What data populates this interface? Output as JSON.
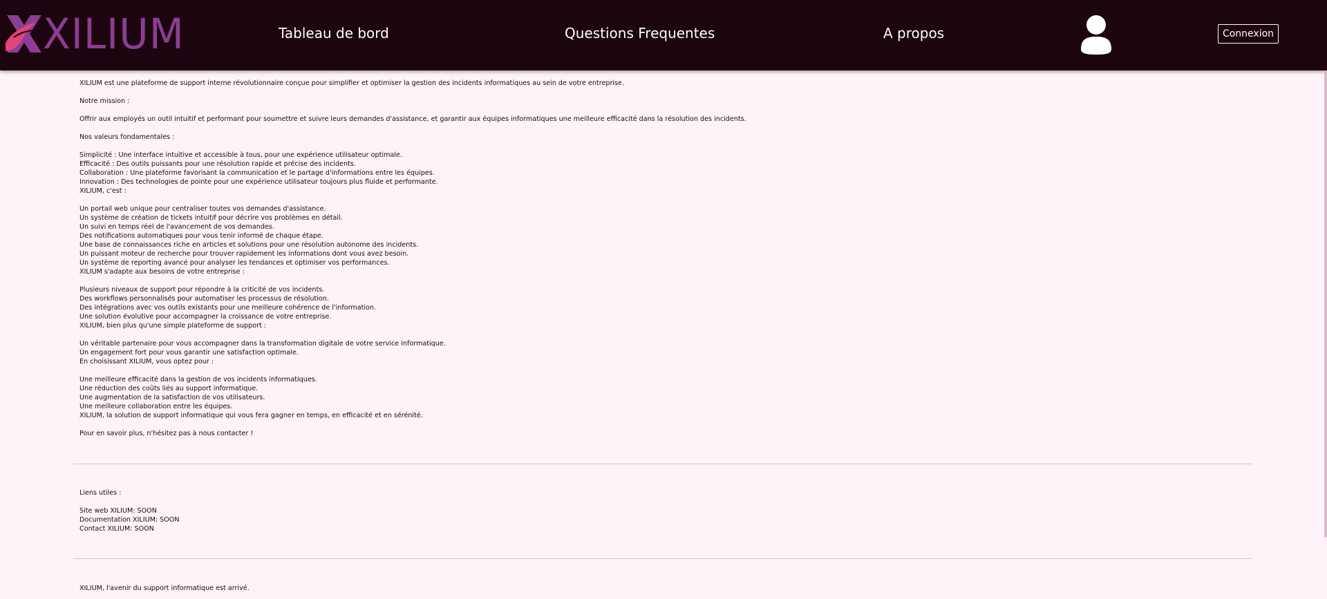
{
  "brand": {
    "name": "XILIUM",
    "logo_color": "#8c3d94",
    "logo_accent_color": "#e0457b"
  },
  "nav": {
    "dashboard_label": "Tableau de bord",
    "faq_label": "Questions Frequentes",
    "about_label": "A propos",
    "user_icon": "user-avatar-icon",
    "login_label": "Connexion"
  },
  "colors": {
    "navbar_bg": "#1c050e",
    "page_bg": "#fdf3f8",
    "text": "#1a0a10"
  },
  "content": {
    "intro": "XILIUM est une plateforme de support interne révolutionnaire conçue pour simplifier et optimiser la gestion des incidents informatiques au sein de votre entreprise.",
    "mission_title": "Notre mission :",
    "mission_text": "Offrir aux employés un outil intuitif et performant pour soumettre et suivre leurs demandes d'assistance, et garantir aux équipes informatiques une meilleure efficacité dans la résolution des incidents.",
    "values_title": "Nos valeurs fondamentales :",
    "values": [
      "Simplicité : Une interface intuitive et accessible à tous, pour une expérience utilisateur optimale.",
      "Efficacité : Des outils puissants pour une résolution rapide et précise des incidents.",
      "Collaboration : Une plateforme favorisant la communication et le partage d'informations entre les équipes.",
      "Innovation : Des technologies de pointe pour une expérience utilisateur toujours plus fluide et performante."
    ],
    "features_title": "XILIUM, c'est :",
    "features": [
      "Un portail web unique pour centraliser toutes vos demandes d'assistance.",
      "Un système de création de tickets intuitif pour décrire vos problèmes en détail.",
      "Un suivi en temps réel de l'avancement de vos demandes.",
      "Des notifications automatiques pour vous tenir informé de chaque étape.",
      "Une base de connaissances riche en articles et solutions pour une résolution autonome des incidents.",
      "Un puissant moteur de recherche pour trouver rapidement les informations dont vous avez besoin.",
      "Un système de reporting avancé pour analyser les tendances et optimiser vos performances."
    ],
    "adapts_title": "XILIUM s'adapte aux besoins de votre entreprise :",
    "adapts": [
      "Plusieurs niveaux de support pour répondre à la criticité de vos incidents.",
      "Des workflows personnalisés pour automatiser les processus de résolution.",
      "Des intégrations avec vos outils existants pour une meilleure cohérence de l'information.",
      "Une solution évolutive pour accompagner la croissance de votre entreprise."
    ],
    "more_title": "XILIUM, bien plus qu'une simple plateforme de support :",
    "more": [
      "Un véritable partenaire pour vous accompagner dans la transformation digitale de votre service informatique.",
      "Un engagement fort pour vous garantir une satisfaction optimale."
    ],
    "choose_title": "En choisissant XILIUM, vous optez pour :",
    "choose": [
      "Une meilleure efficacité dans la gestion de vos incidents informatiques.",
      "Une réduction des coûts liés au support informatique.",
      "Une augmentation de la satisfaction de vos utilisateurs.",
      "Une meilleure collaboration entre les équipes."
    ],
    "tagline": "XILIUM, la solution de support informatique qui vous fera gagner en temps, en efficacité et en sérénité.",
    "contact_cta": "Pour en savoir plus, n'hésitez pas à nous contacter !"
  },
  "links": {
    "title": "Liens utiles :",
    "items": [
      "Site web XILIUM: SOON",
      "Documentation XILIUM: SOON",
      "Contact XILIUM: SOON"
    ]
  },
  "footer": {
    "text": "XILIUM, l'avenir du support informatique est arrivé."
  }
}
